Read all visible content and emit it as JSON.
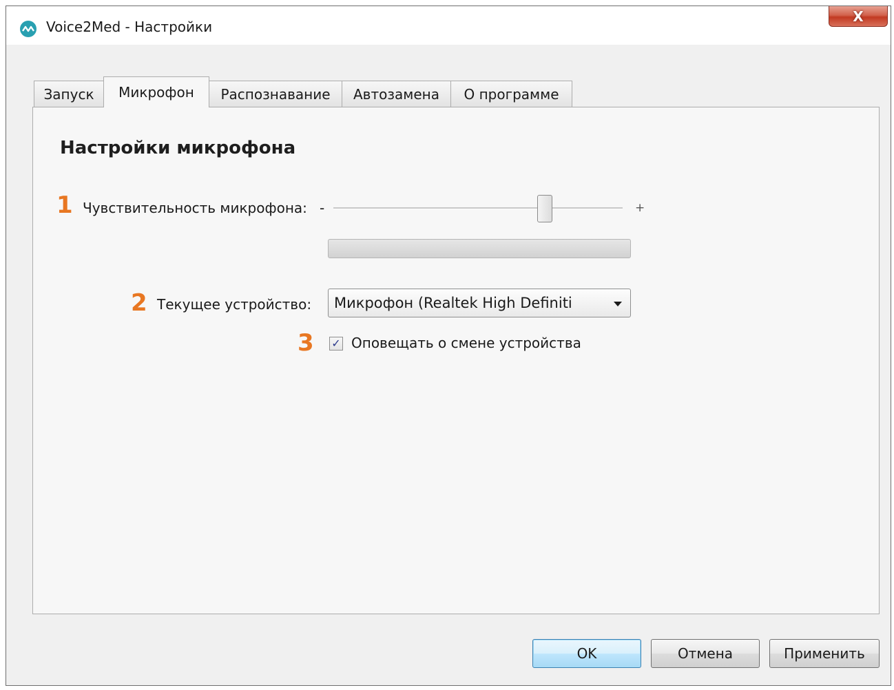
{
  "window": {
    "title": "Voice2Med - Настройки",
    "close_label": "X"
  },
  "tabs": [
    {
      "label": "Запуск",
      "active": false
    },
    {
      "label": "Микрофон",
      "active": true
    },
    {
      "label": "Распознавание",
      "active": false
    },
    {
      "label": "Автозамена",
      "active": false
    },
    {
      "label": "О программе",
      "active": false
    }
  ],
  "microphone": {
    "section_title": "Настройки микрофона",
    "markers": [
      "1",
      "2",
      "3"
    ],
    "sensitivity_label": "Чувствительность микрофона:",
    "sensitivity_minus": "-",
    "sensitivity_plus": "+",
    "sensitivity_level": 0.73,
    "input_level": 0,
    "device_label": "Текущее устройство:",
    "device_value": "Микрофон (Realtek High Definiti",
    "notify_label": "Оповещать о смене устройства",
    "notify_checked": true,
    "checkbox_glyph": "✓"
  },
  "buttons": {
    "ok": "OK",
    "cancel": "Отмена",
    "apply": "Применить"
  },
  "colors": {
    "accent_marker": "#e87722",
    "app_icon": "#29a0b1"
  }
}
